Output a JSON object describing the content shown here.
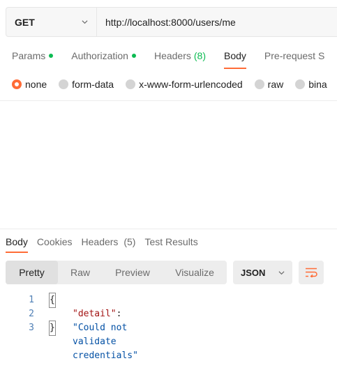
{
  "request": {
    "method": "GET",
    "url": "http://localhost:8000/users/me"
  },
  "request_tabs": [
    {
      "label": "Params",
      "dot": true
    },
    {
      "label": "Authorization",
      "dot": true
    },
    {
      "label": "Headers",
      "count": "(8)"
    },
    {
      "label": "Body",
      "active": true
    },
    {
      "label": "Pre-request S"
    }
  ],
  "body_types": [
    {
      "label": "none",
      "selected": true
    },
    {
      "label": "form-data"
    },
    {
      "label": "x-www-form-urlencoded"
    },
    {
      "label": "raw"
    },
    {
      "label": "bina"
    }
  ],
  "response_tabs": [
    {
      "label": "Body",
      "active": true
    },
    {
      "label": "Cookies"
    },
    {
      "label": "Headers",
      "count": "(5)"
    },
    {
      "label": "Test Results"
    }
  ],
  "format_modes": [
    "Pretty",
    "Raw",
    "Preview",
    "Visualize"
  ],
  "active_format": "Pretty",
  "language": "JSON",
  "code_lines": [
    {
      "number": "1",
      "text": "{"
    },
    {
      "number": "2",
      "key": "\"detail\"",
      "colon": ": ",
      "value": "\"Could not validate credentials\""
    },
    {
      "number": "3",
      "text": "}"
    }
  ],
  "colors": {
    "accent": "#ff6c37",
    "status_dot": "#0cbb52",
    "json_key": "#a31515",
    "json_string": "#0451a5"
  },
  "icons": {
    "method_dropdown": "chevron-down-icon",
    "language_dropdown": "chevron-down-icon",
    "wrap": "wrap-lines-icon"
  }
}
